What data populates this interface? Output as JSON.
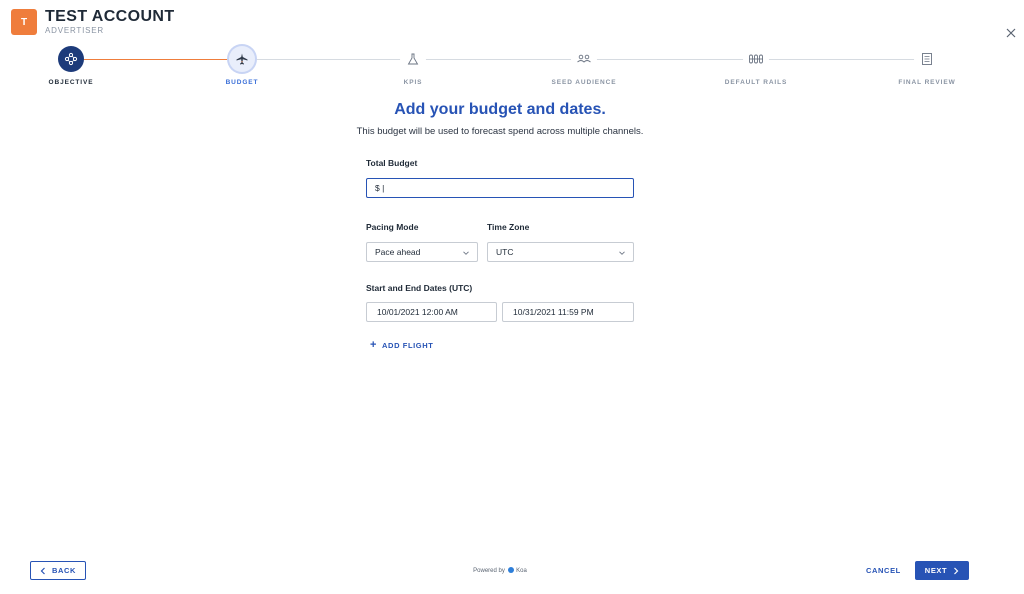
{
  "header": {
    "avatar_letter": "T",
    "account_name": "TEST ACCOUNT",
    "account_role": "ADVERTISER"
  },
  "stepper": {
    "steps": [
      {
        "label": "OBJECTIVE",
        "state": "complete",
        "icon": "network-icon"
      },
      {
        "label": "BUDGET",
        "state": "current",
        "icon": "airplane-icon"
      },
      {
        "label": "KPIS",
        "state": "upcoming",
        "icon": "flask-icon"
      },
      {
        "label": "SEED AUDIENCE",
        "state": "upcoming",
        "icon": "people-icon"
      },
      {
        "label": "DEFAULT RAILS",
        "state": "upcoming",
        "icon": "rails-icon"
      },
      {
        "label": "FINAL REVIEW",
        "state": "upcoming",
        "icon": "checklist-icon"
      }
    ]
  },
  "main": {
    "title": "Add your budget and dates.",
    "subtitle": "This budget will be used to forecast spend across multiple channels.",
    "total_budget": {
      "label": "Total Budget",
      "value": "$ |"
    },
    "pacing_mode": {
      "label": "Pacing Mode",
      "value": "Pace ahead"
    },
    "time_zone": {
      "label": "Time Zone",
      "value": "UTC"
    },
    "dates": {
      "label": "Start and End Dates (UTC)",
      "start": "10/01/2021 12:00 AM",
      "end": "10/31/2021 11:59 PM"
    },
    "add_flight_label": "ADD FLIGHT"
  },
  "footer": {
    "back_label": "BACK",
    "powered_prefix": "Powered by",
    "powered_brand": "Koa",
    "cancel_label": "CANCEL",
    "next_label": "NEXT"
  },
  "colors": {
    "accent": "#2753b5",
    "brand_orange": "#ef7d3c",
    "complete_step": "#1d3b7a"
  }
}
